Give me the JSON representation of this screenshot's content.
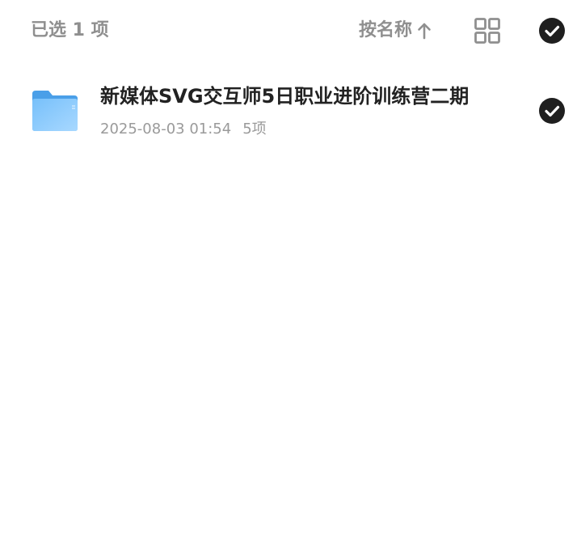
{
  "header": {
    "selected_text": "已选 1 项",
    "sort_label": "按名称",
    "sort_icon": "arrow-up-icon",
    "view_icon": "grid-view-icon",
    "select_all_icon": "check-circle-icon"
  },
  "files": [
    {
      "name": "新媒体SVG交互师5日职业进阶训练营二期",
      "date": "2025-08-03 01:54",
      "count": "5项",
      "type_icon": "folder-icon",
      "selected": true
    }
  ],
  "colors": {
    "muted_text": "#8f8f8f",
    "primary_text": "#222222",
    "check_fill": "#1f1f1f",
    "folder_blue": "#5aaef5"
  }
}
